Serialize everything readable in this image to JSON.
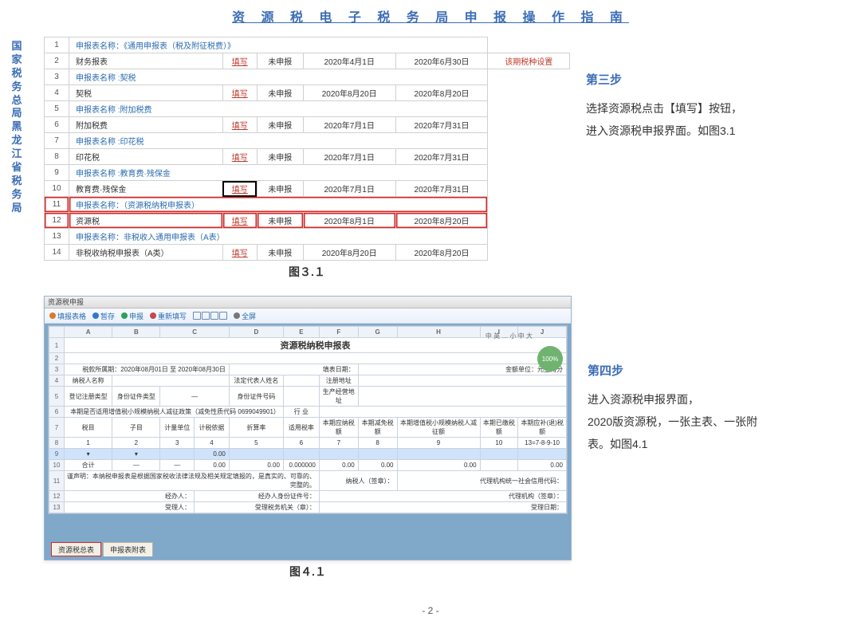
{
  "doc": {
    "title": "资 源 税 电 子 税 务 局 申 报 操 作 指 南",
    "side_org": "国家税务总局黑龙江省税务局",
    "page_num": "- 2 -"
  },
  "fig31": {
    "caption": "图３.１",
    "rows": [
      {
        "n": "1",
        "name": "申报表名称：《通用申报表（税及附征税费）》",
        "link": true
      },
      {
        "n": "2",
        "name": "财务报表",
        "fill": "填写",
        "status": "未申报",
        "start": "2020年4月1日",
        "end": "2020年6月30日",
        "note": "该期税种设置",
        "warn": true
      },
      {
        "n": "3",
        "name": "申报表名称 :契税",
        "link": true
      },
      {
        "n": "4",
        "name": "契税",
        "fill": "填写",
        "status": "未申报",
        "start": "2020年8月20日",
        "end": "2020年8月20日",
        "underline": true
      },
      {
        "n": "5",
        "name": "申报表名称 :附加税费",
        "link": true
      },
      {
        "n": "6",
        "name": "附加税费",
        "fill": "填写",
        "status": "未申报",
        "start": "2020年7月1日",
        "end": "2020年7月31日"
      },
      {
        "n": "7",
        "name": "申报表名称 :印花税",
        "link": true
      },
      {
        "n": "8",
        "name": "印花税",
        "fill": "填写",
        "status": "未申报",
        "start": "2020年7月1日",
        "end": "2020年7月31日"
      },
      {
        "n": "9",
        "name": "申报表名称 :教育费·残保金",
        "link": true
      },
      {
        "n": "10",
        "name": "教育费·残保金",
        "fill": "填写",
        "status": "未申报",
        "start": "2020年7月1日",
        "end": "2020年7月31日",
        "boxed": true
      },
      {
        "n": "11",
        "name": "申报表名称：（资源税纳税申报表）",
        "link": true,
        "hl": true
      },
      {
        "n": "12",
        "name": "资源税",
        "fill": "填写",
        "status": "未申报",
        "start": "2020年8月1日",
        "end": "2020年8月20日",
        "hl": true
      },
      {
        "n": "13",
        "name": "申报表名称：非税收入通用申报表（A表）",
        "link": true
      },
      {
        "n": "14",
        "name": "非税收纳税申报表（A类）",
        "fill": "填写",
        "status": "未申报",
        "start": "2020年8月20日",
        "end": "2020年8月20日"
      }
    ]
  },
  "fig41": {
    "caption": "图４.１",
    "window_title": "资源税申报",
    "toolbar": {
      "refresh": "填报表格",
      "save": "暂存",
      "submit": "申报",
      "reset": "重新填写",
      "zoom": "全屏"
    },
    "sheet": {
      "title": "资源税纳税申报表",
      "period_label": "税款所属期：",
      "period": "2020年08月01日 至 2020年08月30日",
      "filldate_label": "填表日期：",
      "unit_label": "金额单位：元至角分",
      "fields": {
        "nsrmc": "纳税人名称",
        "fddbr": "法定代表人姓名",
        "zcdz": "注册地址",
        "djzclx": "登记注册类型",
        "sfzjlx": "身份证件类型",
        "sfzjhm": "身份证件号码",
        "scjydz": "生产经营地址",
        "note": "本期是否适用增值税小规模纳税人减征政策（减免性质代码 0699049901）",
        "hy": "行 业"
      },
      "cols": {
        "sz": "税目",
        "zm": "子目",
        "jldw": "计量单位",
        "jsxybm": "计税依据",
        "zsl": "折算率",
        "syssl": "适用税率",
        "bqybtse": "本期应纳税额",
        "bqjmse": "本期减免税额",
        "small": "本期增值税小规模纳税人减征额",
        "bqyjse": "本期已缴税额",
        "bqhj": "本期应补(退)税额"
      },
      "col_formula": "13=7-8-9-10",
      "col_idx": [
        "1",
        "2",
        "3",
        "4",
        "5",
        "6",
        "7",
        "8",
        "9",
        "10"
      ],
      "hj": "合计",
      "dash": "—",
      "zeros": [
        "0.00",
        "0.00",
        "0.000000",
        "0.00",
        "0.00",
        "0.00",
        "0.00"
      ],
      "disclaimer": "谨声明：本纳税申报表是根据国家税收法律法规及相关规定填报的，是真实的、可靠的、完整的。",
      "sign": {
        "nsr": "纳税人（签章）：",
        "jbr": "经办人：",
        "sfzj": "经办人身份证件号：",
        "dlr": "代理机构（签章）：",
        "dljg": "代理机构统一社会信用代码：",
        "slr": "受理人：",
        "sljg": "受理税务机关（章）：",
        "slrq": "受理日期："
      }
    },
    "tabs": {
      "t1": "资源税总表",
      "t2": "申报表附表"
    },
    "badge": "100%",
    "hint": "中 英 …\n小   中   大"
  },
  "steps": {
    "s3_h": "第三步",
    "s3_1": "选择资源税点击【填写】按钮，",
    "s3_2": "进入资源税申报界面。如图3.1",
    "s4_h": "第四步",
    "s4_1": "进入资源税申报界面，",
    "s4_2": "2020版资源税，一张主表、一张附",
    "s4_3": "表。如图4.1"
  }
}
